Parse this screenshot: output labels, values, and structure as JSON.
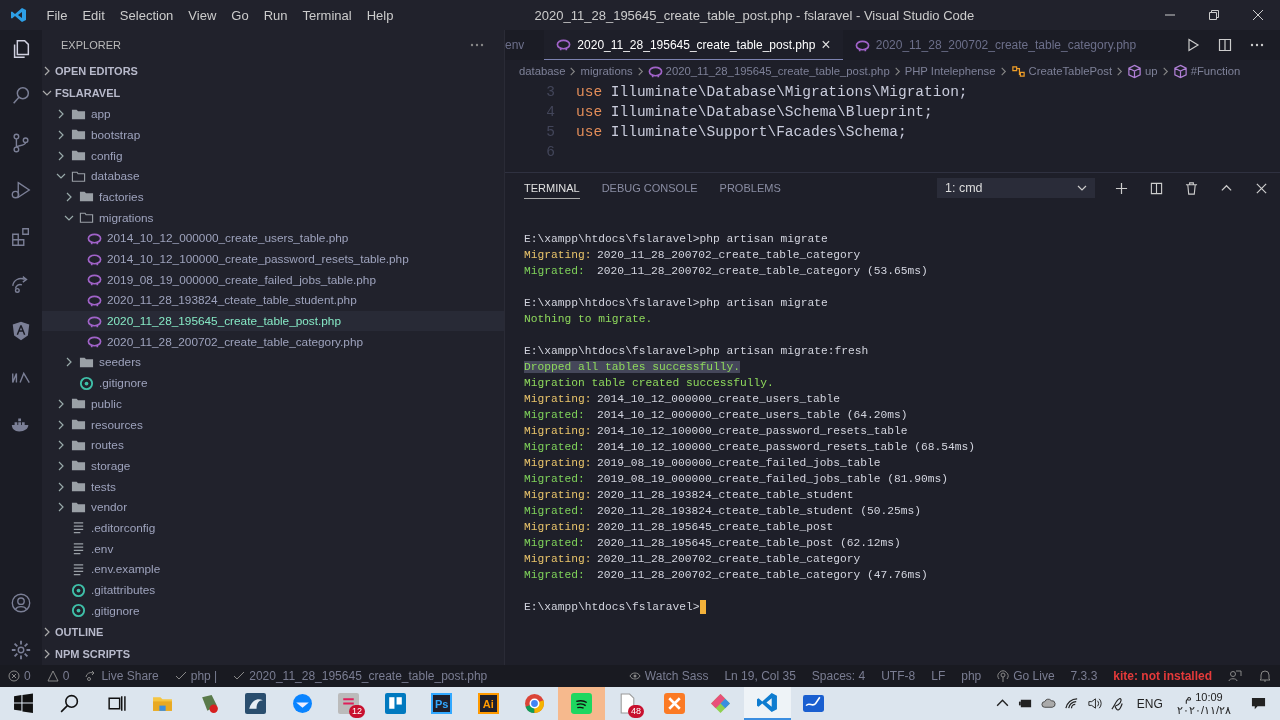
{
  "window": {
    "menus": [
      "File",
      "Edit",
      "Selection",
      "View",
      "Go",
      "Run",
      "Terminal",
      "Help"
    ],
    "title": "2020_11_28_195645_create_table_post.php - fslaravel - Visual Studio Code"
  },
  "explorer": {
    "title": "EXPLORER",
    "sections_top": [
      {
        "label": "OPEN EDITORS",
        "expanded": false
      },
      {
        "label": "FSLARAVEL",
        "expanded": true
      }
    ],
    "tree": [
      {
        "name": "app",
        "kind": "folder",
        "expanded": false,
        "selected": false
      },
      {
        "name": "bootstrap",
        "kind": "folder",
        "expanded": false,
        "selected": false
      },
      {
        "name": "config",
        "kind": "folder",
        "expanded": false,
        "selected": false
      },
      {
        "name": "database",
        "kind": "folder",
        "expanded": true,
        "selected": false,
        "children": [
          {
            "name": "factories",
            "kind": "folder",
            "expanded": false,
            "selected": false
          },
          {
            "name": "migrations",
            "kind": "folder",
            "expanded": true,
            "selected": false,
            "children": [
              {
                "name": "2014_10_12_000000_create_users_table.php",
                "kind": "php",
                "selected": false
              },
              {
                "name": "2014_10_12_100000_create_password_resets_table.php",
                "kind": "php",
                "selected": false
              },
              {
                "name": "2019_08_19_000000_create_failed_jobs_table.php",
                "kind": "php",
                "selected": false
              },
              {
                "name": "2020_11_28_193824_cteate_table_student.php",
                "kind": "php",
                "selected": false
              },
              {
                "name": "2020_11_28_195645_create_table_post.php",
                "kind": "php",
                "selected": true
              },
              {
                "name": "2020_11_28_200702_create_table_category.php",
                "kind": "php",
                "selected": false
              }
            ]
          },
          {
            "name": "seeders",
            "kind": "folder",
            "expanded": false,
            "selected": false
          },
          {
            "name": ".gitignore",
            "kind": "git",
            "selected": false
          }
        ]
      },
      {
        "name": "public",
        "kind": "folder",
        "expanded": false,
        "selected": false
      },
      {
        "name": "resources",
        "kind": "folder",
        "expanded": false,
        "selected": false
      },
      {
        "name": "routes",
        "kind": "folder",
        "expanded": false,
        "selected": false
      },
      {
        "name": "storage",
        "kind": "folder",
        "expanded": false,
        "selected": false
      },
      {
        "name": "tests",
        "kind": "folder",
        "expanded": false,
        "selected": false
      },
      {
        "name": "vendor",
        "kind": "folder",
        "expanded": false,
        "selected": false
      },
      {
        "name": ".editorconfig",
        "kind": "file",
        "selected": false
      },
      {
        "name": ".env",
        "kind": "file",
        "selected": false
      },
      {
        "name": ".env.example",
        "kind": "file",
        "selected": false
      },
      {
        "name": ".gitattributes",
        "kind": "git",
        "selected": false
      },
      {
        "name": ".gitignore",
        "kind": "git",
        "selected": false
      }
    ],
    "sections_bottom": [
      {
        "label": "OUTLINE",
        "expanded": false
      },
      {
        "label": "NPM SCRIPTS",
        "expanded": false
      }
    ]
  },
  "editor": {
    "tabs": [
      {
        "label": "env",
        "kind": "plain",
        "selected": false
      },
      {
        "label": "2020_11_28_195645_create_table_post.php",
        "kind": "php",
        "selected": true
      },
      {
        "label": "2020_11_28_200702_create_table_category.php",
        "kind": "php",
        "selected": false
      }
    ],
    "close": "×",
    "breadcrumb": [
      {
        "label": "database",
        "kind": "plain"
      },
      {
        "label": "migrations",
        "kind": "plain"
      },
      {
        "label": "2020_11_28_195645_create_table_post.php",
        "kind": "php"
      },
      {
        "label": "PHP Intelephense",
        "kind": "plain"
      },
      {
        "label": "CreateTablePost",
        "kind": "class"
      },
      {
        "label": "up",
        "kind": "method"
      },
      {
        "label": "#Function",
        "kind": "method"
      }
    ],
    "lines": [
      {
        "number": "3",
        "keyword": "use",
        "text": "Illuminate\\Database\\Migrations\\Migration;"
      },
      {
        "number": "4",
        "keyword": "use",
        "text": "Illuminate\\Database\\Schema\\Blueprint;"
      },
      {
        "number": "5",
        "keyword": "use",
        "text": "Illuminate\\Support\\Facades\\Schema;"
      },
      {
        "number": "6"
      }
    ]
  },
  "panel": {
    "tabs": [
      {
        "label": "TERMINAL",
        "selected": true
      },
      {
        "label": "DEBUG CONSOLE",
        "selected": false
      },
      {
        "label": "PROBLEMS",
        "selected": false
      }
    ],
    "terminal_select": "1: cmd",
    "lines": [
      {
        "kind": "prompt",
        "text": "E:\\xampp\\htdocs\\fslaravel>php artisan migrate"
      },
      {
        "kind": "migrating",
        "label": "Migrating:",
        "text": "2020_11_28_200702_create_table_category"
      },
      {
        "kind": "migrated",
        "label": "Migrated:",
        "text": "2020_11_28_200702_create_table_category (53.65ms)"
      },
      {
        "kind": "blank"
      },
      {
        "kind": "prompt",
        "text": "E:\\xampp\\htdocs\\fslaravel>php artisan migrate"
      },
      {
        "kind": "info",
        "text": "Nothing to migrate."
      },
      {
        "kind": "blank"
      },
      {
        "kind": "prompt",
        "text": "E:\\xampp\\htdocs\\fslaravel>php artisan migrate:fresh"
      },
      {
        "kind": "info",
        "text": "Dropped all tables successfully.",
        "highlighted": true
      },
      {
        "kind": "info",
        "text": "Migration table created successfully."
      },
      {
        "kind": "migrating",
        "label": "Migrating:",
        "text": "2014_10_12_000000_create_users_table"
      },
      {
        "kind": "migrated",
        "label": "Migrated:",
        "text": "2014_10_12_000000_create_users_table (64.20ms)"
      },
      {
        "kind": "migrating",
        "label": "Migrating:",
        "text": "2014_10_12_100000_create_password_resets_table"
      },
      {
        "kind": "migrated",
        "label": "Migrated:",
        "text": "2014_10_12_100000_create_password_resets_table (68.54ms)"
      },
      {
        "kind": "migrating",
        "label": "Migrating:",
        "text": "2019_08_19_000000_create_failed_jobs_table"
      },
      {
        "kind": "migrated",
        "label": "Migrated:",
        "text": "2019_08_19_000000_create_failed_jobs_table (81.90ms)"
      },
      {
        "kind": "migrating",
        "label": "Migrating:",
        "text": "2020_11_28_193824_cteate_table_student"
      },
      {
        "kind": "migrated",
        "label": "Migrated:",
        "text": "2020_11_28_193824_cteate_table_student (50.25ms)"
      },
      {
        "kind": "migrating",
        "label": "Migrating:",
        "text": "2020_11_28_195645_create_table_post"
      },
      {
        "kind": "migrated",
        "label": "Migrated:",
        "text": "2020_11_28_195645_create_table_post (62.12ms)"
      },
      {
        "kind": "migrating",
        "label": "Migrating:",
        "text": "2020_11_28_200702_create_table_category"
      },
      {
        "kind": "migrated",
        "label": "Migrated:",
        "text": "2020_11_28_200702_create_table_category (47.76ms)"
      },
      {
        "kind": "blank"
      },
      {
        "kind": "prompt",
        "text": "E:\\xampp\\htdocs\\fslaravel>"
      }
    ]
  },
  "status_bar": {
    "left": [
      {
        "kind": "errors",
        "text": "0"
      },
      {
        "kind": "warnings",
        "text": "0"
      },
      {
        "kind": "liveshare",
        "text": "Live Share"
      },
      {
        "kind": "check",
        "text": "php |"
      },
      {
        "kind": "check",
        "text": "2020_11_28_195645_create_table_post.php"
      }
    ],
    "right": [
      {
        "kind": "eye",
        "text": "Watch Sass"
      },
      {
        "kind": "plain",
        "text": "Ln 19, Col 35"
      },
      {
        "kind": "plain",
        "text": "Spaces: 4"
      },
      {
        "kind": "plain",
        "text": "UTF-8"
      },
      {
        "kind": "plain",
        "text": "LF"
      },
      {
        "kind": "plain",
        "text": "php"
      },
      {
        "kind": "golive",
        "text": "Go Live"
      },
      {
        "kind": "plain",
        "text": "7.3.3"
      },
      {
        "kind": "alert",
        "text": "kite: not installed"
      }
    ]
  },
  "taskbar": {
    "apps": [
      {
        "kind": "start",
        "selected": false,
        "attention": false
      },
      {
        "kind": "search",
        "selected": false,
        "attention": false
      },
      {
        "kind": "taskview",
        "selected": false,
        "attention": false
      },
      {
        "kind": "folder",
        "selected": false,
        "attention": false
      },
      {
        "kind": "tool",
        "selected": false,
        "attention": false
      },
      {
        "kind": "dolphin",
        "selected": false,
        "attention": false
      },
      {
        "kind": "mail",
        "selected": false,
        "attention": false
      },
      {
        "kind": "chat",
        "badge": "12",
        "selected": false,
        "attention": false
      },
      {
        "kind": "board",
        "selected": false,
        "attention": false
      },
      {
        "kind": "letters",
        "label": "Ps",
        "color": "#31a8ff",
        "selected": false,
        "attention": false
      },
      {
        "kind": "letters",
        "label": "Ai",
        "color": "#ff9a00",
        "selected": false,
        "attention": false
      },
      {
        "kind": "browser",
        "selected": false,
        "attention": false
      },
      {
        "kind": "music",
        "selected": false,
        "attention": true
      },
      {
        "kind": "document",
        "badge": "48",
        "selected": false,
        "attention": false
      },
      {
        "kind": "server",
        "selected": false,
        "attention": false
      },
      {
        "kind": "diamond",
        "selected": false,
        "attention": false
      },
      {
        "kind": "code",
        "selected": true,
        "attention": false
      },
      {
        "kind": "whiteboard",
        "selected": false,
        "attention": false
      }
    ],
    "language": "ENG",
    "time": "10:09 م",
    "date": "٢٠٢٠/١١/٢٨"
  }
}
